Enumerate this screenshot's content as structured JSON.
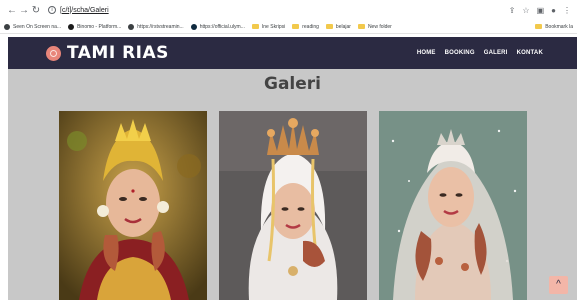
{
  "browser": {
    "address": "[c/t]/scha/Galeri",
    "bookmarks": [
      {
        "label": "Seen On Screen na...",
        "kind": "site",
        "color": "#3c4043"
      },
      {
        "label": "Binomo - Platform...",
        "kind": "site",
        "color": "#1b1b1b"
      },
      {
        "label": "https://rstvstreamin...",
        "kind": "site",
        "color": "#3c4043"
      },
      {
        "label": "https://official.ulym...",
        "kind": "site",
        "color": "#0f2a3f"
      },
      {
        "label": "Ine Skripsi",
        "kind": "folder"
      },
      {
        "label": "reading",
        "kind": "folder"
      },
      {
        "label": "belajar",
        "kind": "folder"
      },
      {
        "label": "New folder",
        "kind": "folder"
      }
    ],
    "bookmarks_right": "Bookmark la"
  },
  "site": {
    "logo_text": "TAMI RIAS",
    "nav": [
      "HOME",
      "BOOKING",
      "GALERI",
      "KONTAK"
    ],
    "accent_color": "#e8857a",
    "header_color": "#2b2a42"
  },
  "gallery": {
    "title": "Galeri",
    "photos": [
      {
        "icon": "bride-photo-gold-crown"
      },
      {
        "icon": "bride-photo-white-hijab"
      },
      {
        "icon": "bride-photo-lace-veil"
      }
    ]
  },
  "scroll_top": {
    "icon": "chevron-up-icon"
  }
}
